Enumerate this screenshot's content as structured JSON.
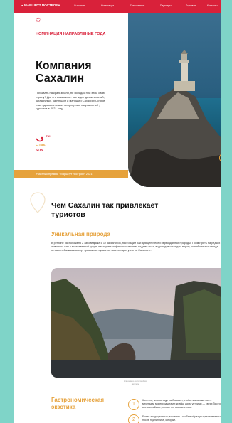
{
  "nav": {
    "logo": "⌁ МАРШРУТ ПОСТРОЕН",
    "items": [
      "О проекте",
      "Номинации",
      "Голосование",
      "Партнеры",
      "Торговля",
      "Контакты"
    ]
  },
  "hero": {
    "nomination": "НОМИНАЦИЯ НАПРАВЛЕНИЕ ГОДА",
    "title": "Компания Сахалин",
    "description": "Побывать на краю земли, не покидая при этом свою страну? Да, это возможно - вас ждет удивительный, загадочный, чарующий и манящий Сахалин! Остров стал одним из самых популярных направлений у туристов в 2021 году.",
    "tui_label": "TUI",
    "fun_label_1": "FUN&",
    "fun_label_2": "SUN",
    "banner": "Участник премии \"Маршрут построен 2021\"",
    "arrow": "↑"
  },
  "section": {
    "title": "Чем Сахалин так привлекает туристов",
    "subtitle1": "Уникальная природа",
    "paragraph": "В регионе расположено 2 заповедника и 12 заказников, настоящий рай для ценителей первозданной природы. Посмотреть на редких животных или в естественной среде, насладиться фантастическими видами скал, водопадов и каждом ворон, полюбоваться иногда огнями пейзажами вокруг тревожных вулканов - все это доступно на Сахалине.",
    "caption": "Ключевая фотография диплом",
    "subtitle2": "Гастрономическая экзотика",
    "items": [
      {
        "num": "1",
        "text": "Конечно, многие едут на Сахалин, чтобы познакомиться с местными морепродуктами: крабы, икра, устрицы — сверх быстро - все свежайшее, только что выловленное."
      },
      {
        "num": "2",
        "text": "Более традиционные угощения - особые образцы приготовленные после подлинника, которые."
      }
    ]
  },
  "colors": {
    "brand_red": "#d9213a",
    "accent_orange": "#e6a23c",
    "background_teal": "#7fd4c8"
  }
}
